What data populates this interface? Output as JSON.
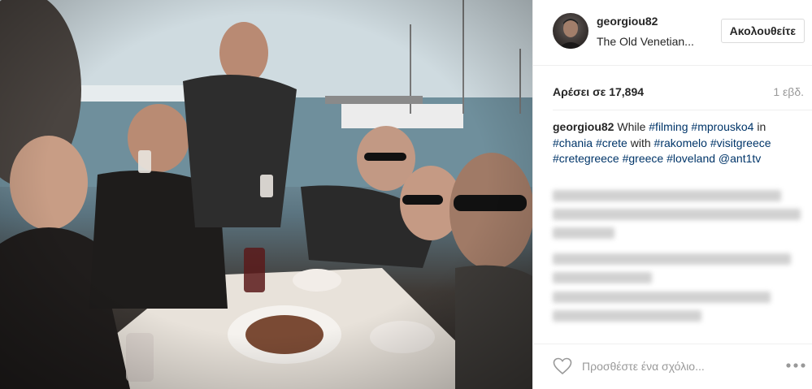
{
  "header": {
    "username": "georgiou82",
    "location": "The Old Venetian...",
    "follow_label": "Ακολουθείτε"
  },
  "stats": {
    "likes": "Αρέσει σε 17,894",
    "time": "1 εβδ."
  },
  "caption": {
    "user": "georgiou82",
    "text_segments": [
      {
        "text": "While ",
        "tag": false
      },
      {
        "text": "#filming",
        "tag": true
      },
      {
        "text": " ",
        "tag": false
      },
      {
        "text": "#mprousko4",
        "tag": true
      },
      {
        "text": " in ",
        "tag": false
      },
      {
        "text": "#chania",
        "tag": true
      },
      {
        "text": " ",
        "tag": false
      },
      {
        "text": "#crete",
        "tag": true
      },
      {
        "text": " with ",
        "tag": false
      },
      {
        "text": "#rakomelo",
        "tag": true
      },
      {
        "text": " ",
        "tag": false
      },
      {
        "text": "#visitgreece",
        "tag": true
      },
      {
        "text": " ",
        "tag": false
      },
      {
        "text": "#cretegreece",
        "tag": true
      },
      {
        "text": " ",
        "tag": false
      },
      {
        "text": "#greece",
        "tag": true
      },
      {
        "text": " ",
        "tag": false
      },
      {
        "text": "#loveland",
        "tag": true
      },
      {
        "text": " ",
        "tag": false
      },
      {
        "text": "@ant1tv",
        "tag": true
      }
    ]
  },
  "comment_box": {
    "placeholder": "Προσθέστε ένα σχόλιο..."
  },
  "icons": {
    "like": "heart-icon",
    "more": "more-options-icon"
  },
  "colors": {
    "text": "#262626",
    "link": "#003569",
    "muted": "#999999",
    "border": "#efefef"
  }
}
